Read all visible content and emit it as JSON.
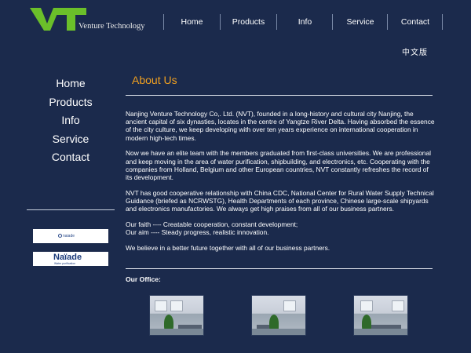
{
  "header": {
    "logo_mark": "VT",
    "logo_text": "Venture Technology",
    "nav": [
      "Home",
      "Products",
      "Info",
      "Service",
      "Contact"
    ],
    "language_link": "中文版"
  },
  "sidebar": {
    "items": [
      "Home",
      "Products",
      "Info",
      "Service",
      "Contact"
    ],
    "partners": [
      {
        "name": "partner-naiade-small",
        "text": "naiade"
      },
      {
        "name": "partner-naiade-large",
        "text": "Naïade",
        "sub": "Water purification"
      }
    ]
  },
  "main": {
    "title": "About Us",
    "paragraphs": [
      "Nanjing Venture Technology Co,. Ltd. (NVT), founded in a long-history and cultural city Nanjing, the ancient capital of six dynasties, locates in the centre of Yangtze River Delta. Having absorbed the essence of the city culture, we keep developing with over ten years experience on international cooperation in modern high-tech times.",
      "Now we have an elite team with the members graduated from first-class universities. We are professional and keep moving in the area of water purification, shipbuilding, and electronics, etc. Cooperating with the companies from Holland, Belgium and other European countries, NVT constantly refreshes the record of its development.",
      "NVT has good cooperative relationship with China CDC, National Center for Rural Water Supply Technical Guidance (briefed as NCRWSTG), Health Departments of each province, Chinese large-scale shipyards and electronics manufactories. We always get high praises from all of our business partners.",
      "Our faith ---- Creatable cooperation, constant development;\nOur aim ---- Steady progress, realistic innovation.",
      "We believe in a better future together with all of our business partners."
    ],
    "office_label": "Our Office:"
  },
  "colors": {
    "background": "#1b2a4c",
    "logo_green": "#6bbf2a",
    "title_orange": "#f0a020",
    "text": "#ffffff"
  }
}
